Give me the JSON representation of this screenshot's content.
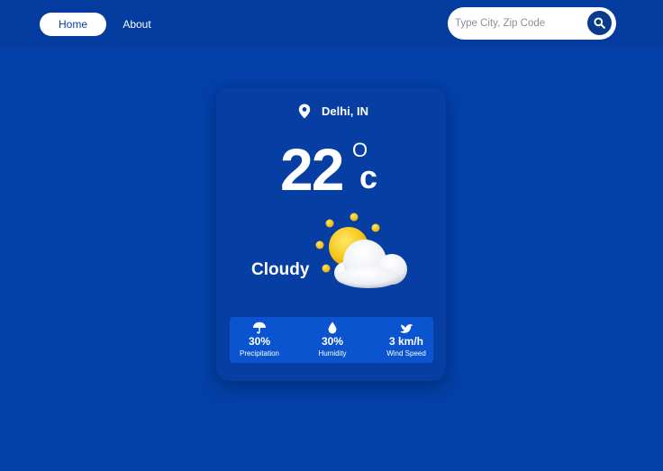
{
  "nav": {
    "home_label": "Home",
    "about_label": "About"
  },
  "search": {
    "placeholder": "Type City, Zip Code",
    "icon": "search-icon"
  },
  "weather": {
    "location": "Delhi, IN",
    "temperature": "22",
    "degree_symbol": "O",
    "unit": "c",
    "condition": "Cloudy",
    "condition_icon": "sun-behind-cloud-icon",
    "stats": [
      {
        "icon": "umbrella-icon",
        "value": "30%",
        "label": "Precipitation"
      },
      {
        "icon": "droplet-icon",
        "value": "30%",
        "label": "Humidity"
      },
      {
        "icon": "bird-icon",
        "value": "3 km/h",
        "label": "Wind Speed"
      }
    ]
  },
  "colors": {
    "background": "#0340a8",
    "navbar": "#033c9e",
    "card": "#063ea3",
    "stats_panel": "#0a55cf",
    "sun": "#f5c518",
    "search_button": "#0a3a8c"
  }
}
